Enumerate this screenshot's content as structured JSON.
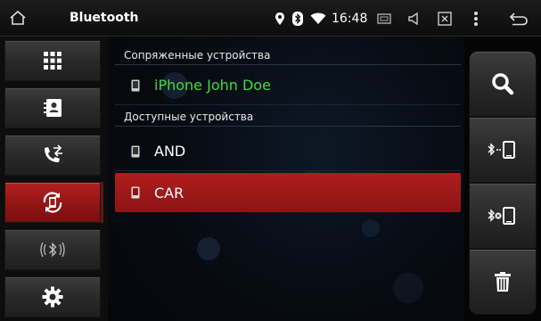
{
  "statusbar": {
    "title": "Bluetooth",
    "time": "16:48",
    "icons": [
      "home-icon",
      "location-icon",
      "bluetooth-icon",
      "wifi-icon",
      "screen-icon",
      "volume-icon",
      "close-window-icon",
      "more-vert-icon",
      "back-icon"
    ]
  },
  "sidebar": {
    "items": [
      {
        "name": "dialpad",
        "icon": "dialpad-icon",
        "active": false
      },
      {
        "name": "contacts",
        "icon": "contacts-icon",
        "active": false
      },
      {
        "name": "call-log",
        "icon": "call-transfer-icon",
        "active": false
      },
      {
        "name": "devices",
        "icon": "phone-sync-icon",
        "active": true
      },
      {
        "name": "bt-music",
        "icon": "bluetooth-audio-icon",
        "active": false
      },
      {
        "name": "settings",
        "icon": "gear-icon",
        "active": false
      }
    ]
  },
  "main": {
    "paired_header": "Сопряженные устройства",
    "available_header": "Доступные устройства",
    "paired_devices": [
      {
        "label": "iPhone John Doe",
        "color": "#3ddc3d"
      }
    ],
    "available_devices": [
      {
        "label": "AND",
        "selected": false
      },
      {
        "label": "CAR",
        "selected": true
      }
    ]
  },
  "actions": [
    {
      "name": "search",
      "icon": "search-icon"
    },
    {
      "name": "connect",
      "icon": "bluetooth-connect-icon"
    },
    {
      "name": "disconnect",
      "icon": "bluetooth-disconnect-icon"
    },
    {
      "name": "delete",
      "icon": "trash-icon"
    }
  ],
  "colors": {
    "accent_red": "#a81818",
    "connected_green": "#3ddc3d"
  }
}
